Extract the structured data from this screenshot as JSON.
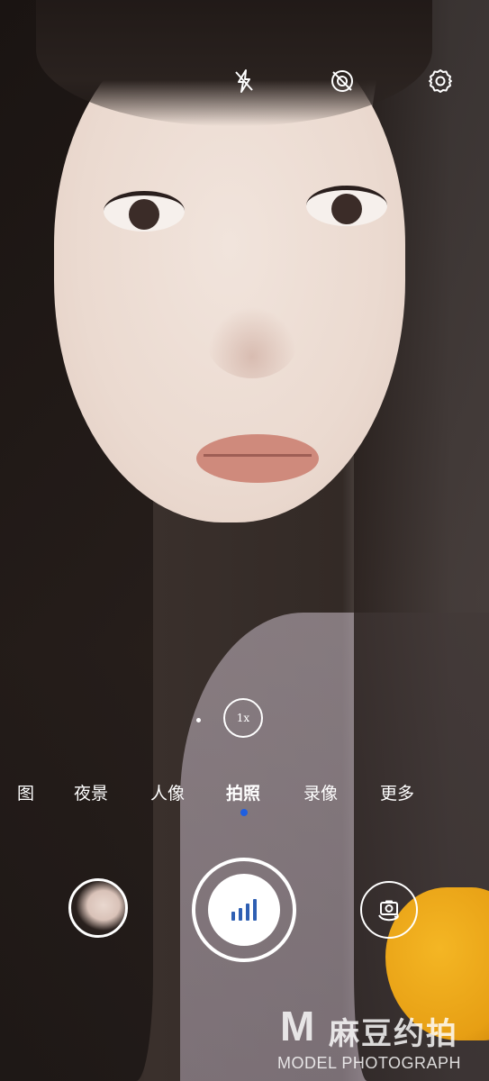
{
  "top_icons": [
    {
      "name": "flash-off-icon"
    },
    {
      "name": "live-photo-off-icon"
    },
    {
      "name": "settings-gear-icon"
    }
  ],
  "zoom": {
    "label": "1x"
  },
  "modes": [
    {
      "label": "图",
      "active": false
    },
    {
      "label": "夜景",
      "active": false
    },
    {
      "label": "人像",
      "active": false
    },
    {
      "label": "拍照",
      "active": true
    },
    {
      "label": "录像",
      "active": false
    },
    {
      "label": "更多",
      "active": false
    }
  ],
  "bottom": {
    "gallery_thumbnail": "gallery-thumbnail",
    "shutter_icon": "signal-bars-icon",
    "switch_camera_icon": "switch-camera-icon"
  },
  "colors": {
    "accent": "#1f5fe0",
    "shutter_bars": "#2f5fb3"
  },
  "watermark": {
    "mark": "M",
    "chinese": "麻豆约拍",
    "english": "MODEL PHOTOGRAPH"
  }
}
